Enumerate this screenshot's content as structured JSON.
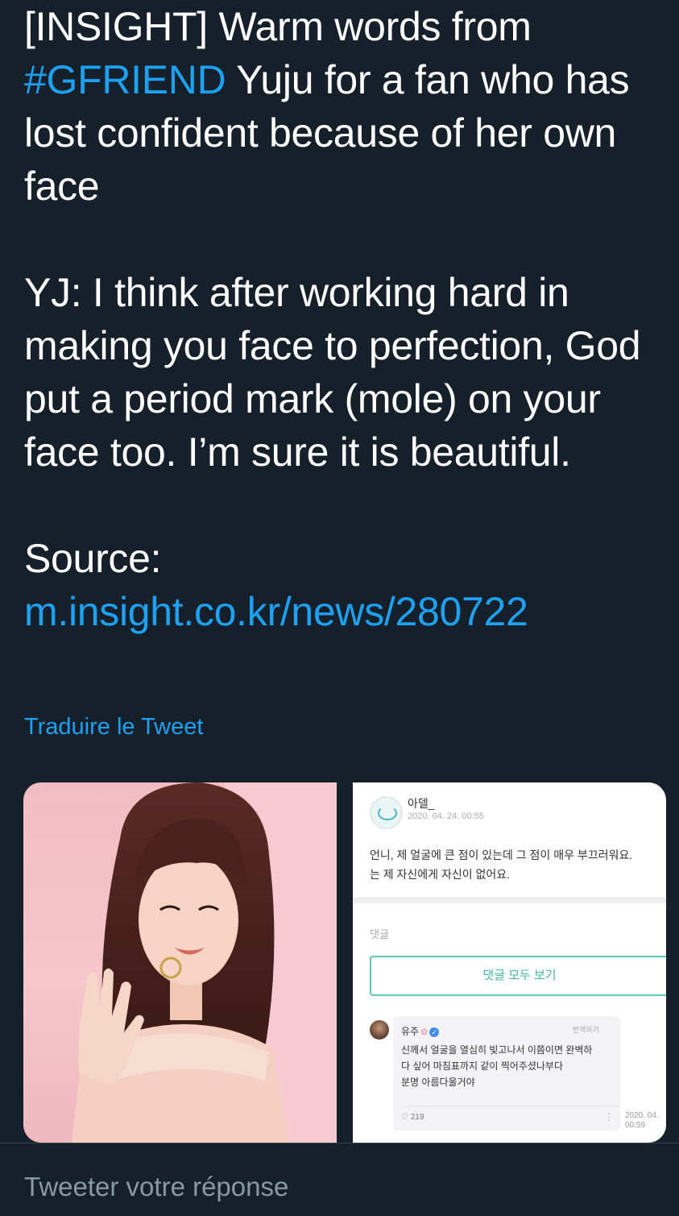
{
  "tweet": {
    "line1_prefix": "[INSIGHT] Warm words from ",
    "hashtag": "#GFRIEND",
    "line1_rest": " Yuju for a fan who has lost confident because of her own face",
    "quote": "YJ: I think after working hard in making you face to perfection, God put a period mark (mole) on your face too. I’m sure it is beautiful.",
    "source_label": "Source: ",
    "source_link": "m.insight.co.kr/news/280722"
  },
  "translate_label": "Traduire le Tweet",
  "media": {
    "photo_alt": "photo",
    "screenshot": {
      "username": "아델_",
      "date": "2020. 04. 24. 00:55",
      "post_line1": "언니, 제 얼굴에 큰 점이 있는데 그 점이 매우 부끄러워요.",
      "post_line2": "는 제 자신에게 자신이 없어요.",
      "comments_label": "댓글",
      "view_all_button": "댓글 모두 보기",
      "reply": {
        "name": "유주",
        "translate": "번역하기",
        "line1": "신께서 얼굴을 열심히 빚고나서 이쯤이면 완벽하",
        "line2": "다 싶어 마침표까지 같이 찍어주셨나부다",
        "line3": "분명 아름다울거야",
        "likes": "219",
        "date_line1": "2020. 04.",
        "date_line2": "00:59"
      }
    }
  },
  "reply_placeholder": "Tweeter votre réponse",
  "colors": {
    "background": "#15202b",
    "link": "#1da1f2",
    "muted": "#8899a6"
  }
}
